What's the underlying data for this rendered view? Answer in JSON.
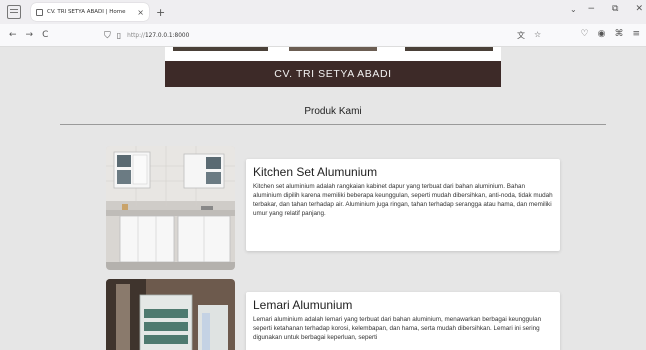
{
  "browser": {
    "tab_title": "CV. TRI SETYA ABADI | Home",
    "tab_close": "×",
    "new_tab": "+",
    "url_prefix": "http://",
    "url_host": "127.0.0.1:8000",
    "back": "←",
    "forward": "→",
    "reload": "C",
    "chevron": "⌄",
    "minimize": "−",
    "restore": "⧉",
    "close": "✕",
    "icons": [
      "tabs-icon",
      "shield-icon",
      "page-icon",
      "translate-icon",
      "star-icon",
      "pocket-icon",
      "account-icon",
      "extensions-icon",
      "menu-icon"
    ]
  },
  "page": {
    "company_name": "CV. TRI SETYA ABADI",
    "section_title": "Produk Kami",
    "products": [
      {
        "title": "Kitchen Set Alumunium",
        "description": "Kitchen set aluminium adalah rangkaian kabinet dapur yang terbuat dari bahan aluminium. Bahan aluminium dipilih karena memiliki beberapa keunggulan, seperti mudah dibersihkan, anti-noda, tidak mudah terbakar, dan tahan terhadap air. Aluminium juga ringan, tahan terhadap serangga atau hama, dan memiliki umur yang relatif panjang."
      },
      {
        "title": "Lemari Alumunium",
        "description": "Lemari aluminium adalah lemari yang terbuat dari bahan aluminium, menawarkan berbagai keunggulan seperti ketahanan terhadap korosi, kelembapan, dan hama, serta mudah dibersihkan. Lemari ini sering digunakan untuk berbagai keperluan, seperti"
      }
    ]
  }
}
